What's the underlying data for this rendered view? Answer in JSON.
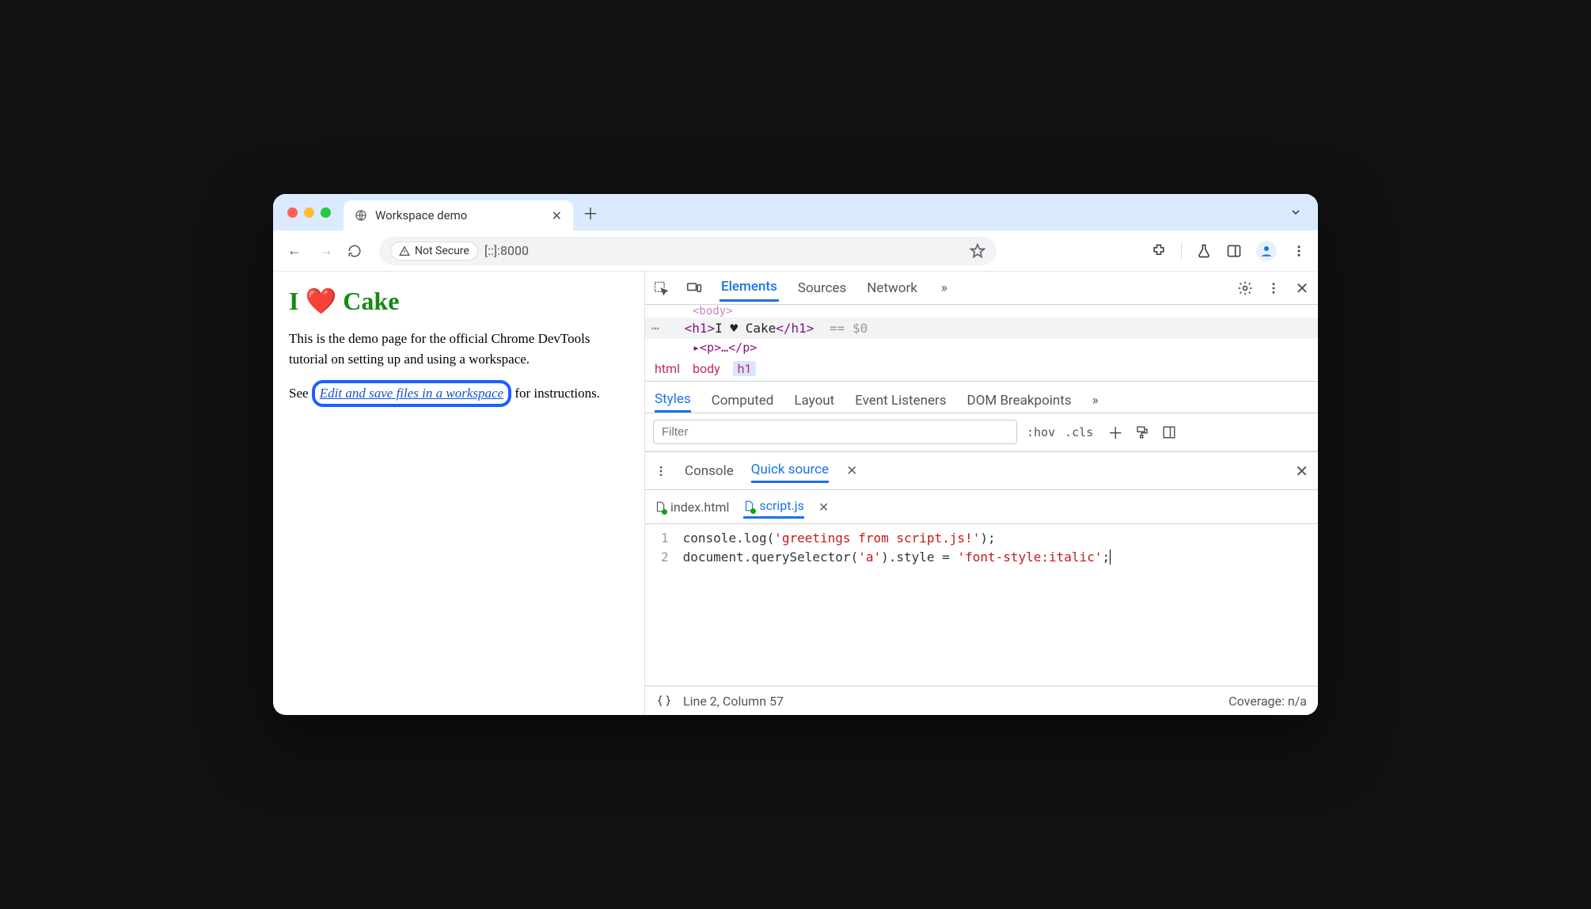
{
  "tab": {
    "title": "Workspace demo"
  },
  "toolbar": {
    "security_label": "Not Secure",
    "url": "[::]:8000"
  },
  "page": {
    "h1_pre": "I ",
    "h1_heart": "❤️",
    "h1_post": " Cake",
    "p1": "This is the demo page for the official Chrome DevTools tutorial on setting up and using a workspace.",
    "p2_pre": "See ",
    "p2_link": "Edit and save files in a workspace",
    "p2_post": " for instructions."
  },
  "devtools": {
    "tabs": {
      "elements": "Elements",
      "sources": "Sources",
      "network": "Network",
      "more": "»"
    },
    "dom": {
      "body_open": "<body>",
      "h1_open": "<h1>",
      "h1_text": "I ♥ Cake",
      "h1_close": "</h1>",
      "selected_marker": "== $0",
      "p_collapsed": "▸<p>…</p>"
    },
    "breadcrumb": {
      "a": "html",
      "b": "body",
      "c": "h1"
    },
    "styles_tabs": {
      "styles": "Styles",
      "computed": "Computed",
      "layout": "Layout",
      "listeners": "Event Listeners",
      "dombp": "DOM Breakpoints",
      "more": "»"
    },
    "filter": {
      "placeholder": "Filter",
      "hov": ":hov",
      "cls": ".cls"
    },
    "drawer": {
      "console": "Console",
      "quicksource": "Quick source"
    },
    "files": {
      "index": "index.html",
      "script": "script.js"
    },
    "code": {
      "l1": "console.log('greetings from script.js!');",
      "l2": "document.querySelector('a').style = 'font-style:italic';"
    },
    "status": {
      "pos": "Line 2, Column 57",
      "coverage": "Coverage: n/a"
    }
  }
}
